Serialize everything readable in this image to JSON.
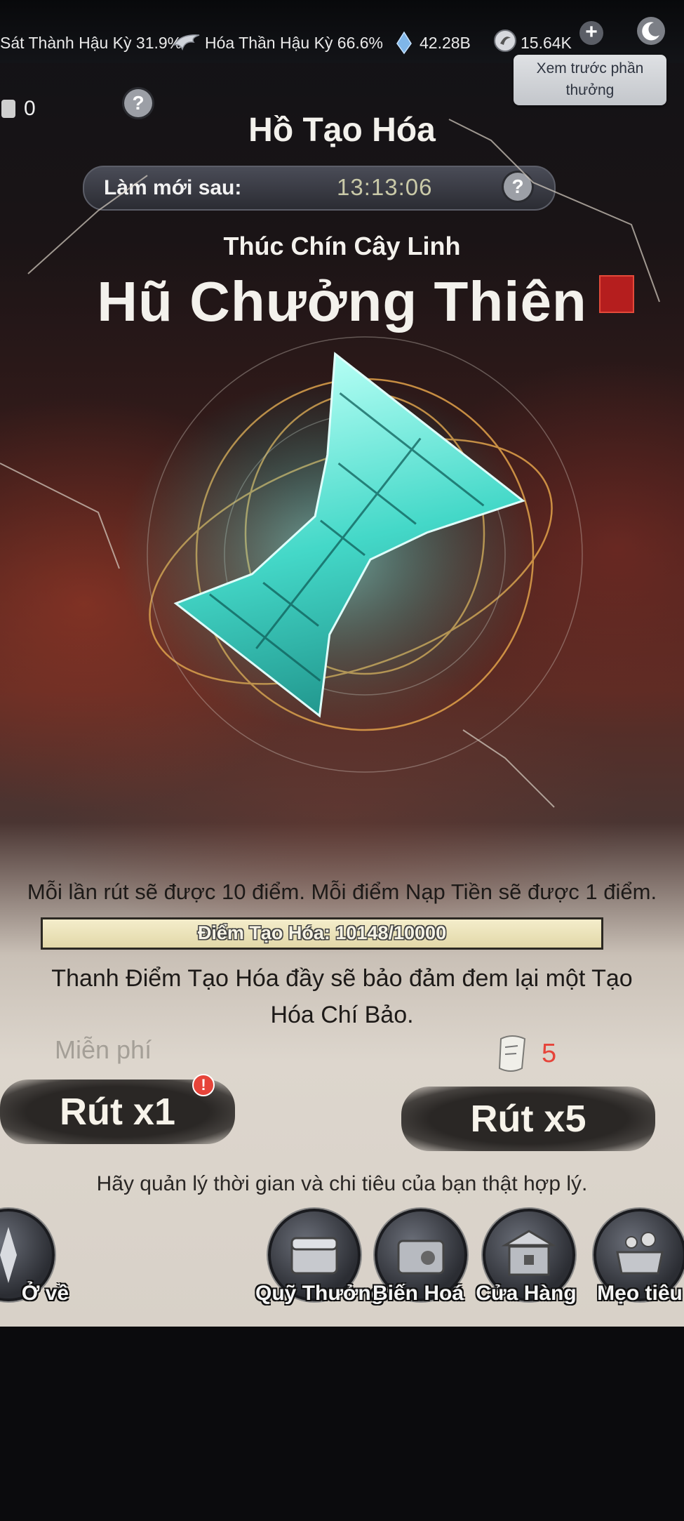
{
  "status_bar": {
    "stage_left": "Sát Thành Hậu Kỳ 31.9%",
    "stage_right": "Hóa Thần Hậu Kỳ 66.6%",
    "currency_spirit": "42.28B",
    "currency_gold": "15.64K",
    "add_icon": "plus-icon",
    "clock_icon": "moon-icon"
  },
  "side": {
    "count": "0"
  },
  "header": {
    "help_label": "?",
    "preview_button": "Xem trước phần thưởng",
    "title": "Hồ Tạo Hóa",
    "refresh_label": "Làm mới sau:",
    "refresh_time": "13:13:06"
  },
  "feature": {
    "subtitle": "Thúc Chín Cây Linh",
    "item_name": "Hũ Chưởng Thiên"
  },
  "info": {
    "rule_text": "Mỗi lần rút sẽ được 10 điểm. Mỗi điểm Nạp Tiền sẽ được 1 điểm.",
    "progress_label": "Điểm Tạo Hóa: 10148/10000",
    "progress_fraction": 1.0,
    "guarantee_text": "Thanh Điểm Tạo Hóa đầy sẽ bảo đảm đem lại một Tạo Hóa Chí Bảo."
  },
  "draw": {
    "free_label": "Miễn phí",
    "draw1_label": "Rút x1",
    "ticket_cost": "5",
    "draw5_label": "Rút x5",
    "notice_icon": "exclamation-icon"
  },
  "footer_note": "Hãy quản lý thời gian và chi tiêu của bạn thật hợp lý.",
  "nav": {
    "back_label": "Ở về",
    "items": [
      {
        "label": "Quỹ Thưởng",
        "icon": "treasure-chest-icon"
      },
      {
        "label": "Biến Hoá",
        "icon": "transform-box-icon"
      },
      {
        "label": "Cửa Hàng",
        "icon": "shop-icon"
      },
      {
        "label": "Mẹo tiêu",
        "icon": "cauldron-icon"
      }
    ]
  },
  "colors": {
    "accent_red": "#e6443a",
    "artifact_cyan": "#5ef2e0",
    "rune_gold": "#e2a24a"
  }
}
